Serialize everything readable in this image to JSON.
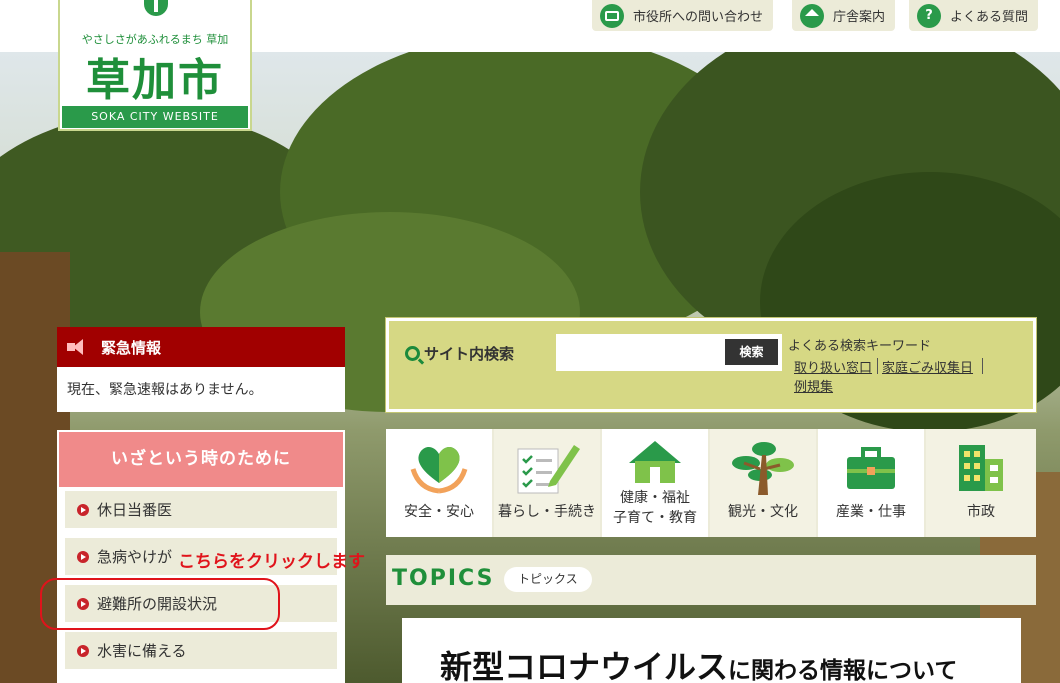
{
  "logo": {
    "tagline": "やさしさがあふれるまち 草加",
    "name": "草加市",
    "english": "SOKA CITY WEBSITE"
  },
  "header_links": [
    {
      "label": "市役所への問い合わせ",
      "icon": "mail-icon"
    },
    {
      "label": "庁舎案内",
      "icon": "building-icon"
    },
    {
      "label": "よくある質問",
      "icon": "question-icon",
      "glyph": "?"
    }
  ],
  "emergency": {
    "title": "緊急情報",
    "message": "現在、緊急速報はありません。",
    "color": "#a10000"
  },
  "preparedness": {
    "title": "いざという時のために",
    "items": [
      "休日当番医",
      "急病やけが",
      "避難所の開設状況",
      "水害に備える"
    ]
  },
  "annotation": {
    "text": "こちらをクリックします",
    "color": "#e0131b"
  },
  "search": {
    "label": "サイト内検索",
    "value": "",
    "button_label": "検索",
    "keywords_title": "よくある検索キーワード",
    "keywords": [
      "取り扱い窓口",
      "家庭ごみ収集日",
      "例規集"
    ]
  },
  "categories": [
    {
      "label": "安全・安心",
      "icon": "heart-hands-icon"
    },
    {
      "label": "暮らし・手続き",
      "icon": "checklist-pencil-icon"
    },
    {
      "label_line1": "健康・福祉",
      "label_line2": "子育て・教育",
      "icon": "house-icon"
    },
    {
      "label": "観光・文化",
      "icon": "pine-tree-icon"
    },
    {
      "label": "産業・仕事",
      "icon": "briefcase-icon"
    },
    {
      "label": "市政",
      "icon": "office-building-icon"
    }
  ],
  "topics": {
    "title": "TOPICS",
    "badge": "トピックス"
  },
  "headline": {
    "big": "新型コロナウイルス",
    "small": "に関わる情報について"
  },
  "colors": {
    "brand_green": "#2a9a4a",
    "search_bg": "#d6d884",
    "prep_header": "#f08a8a",
    "item_bg": "#ecebd9"
  }
}
